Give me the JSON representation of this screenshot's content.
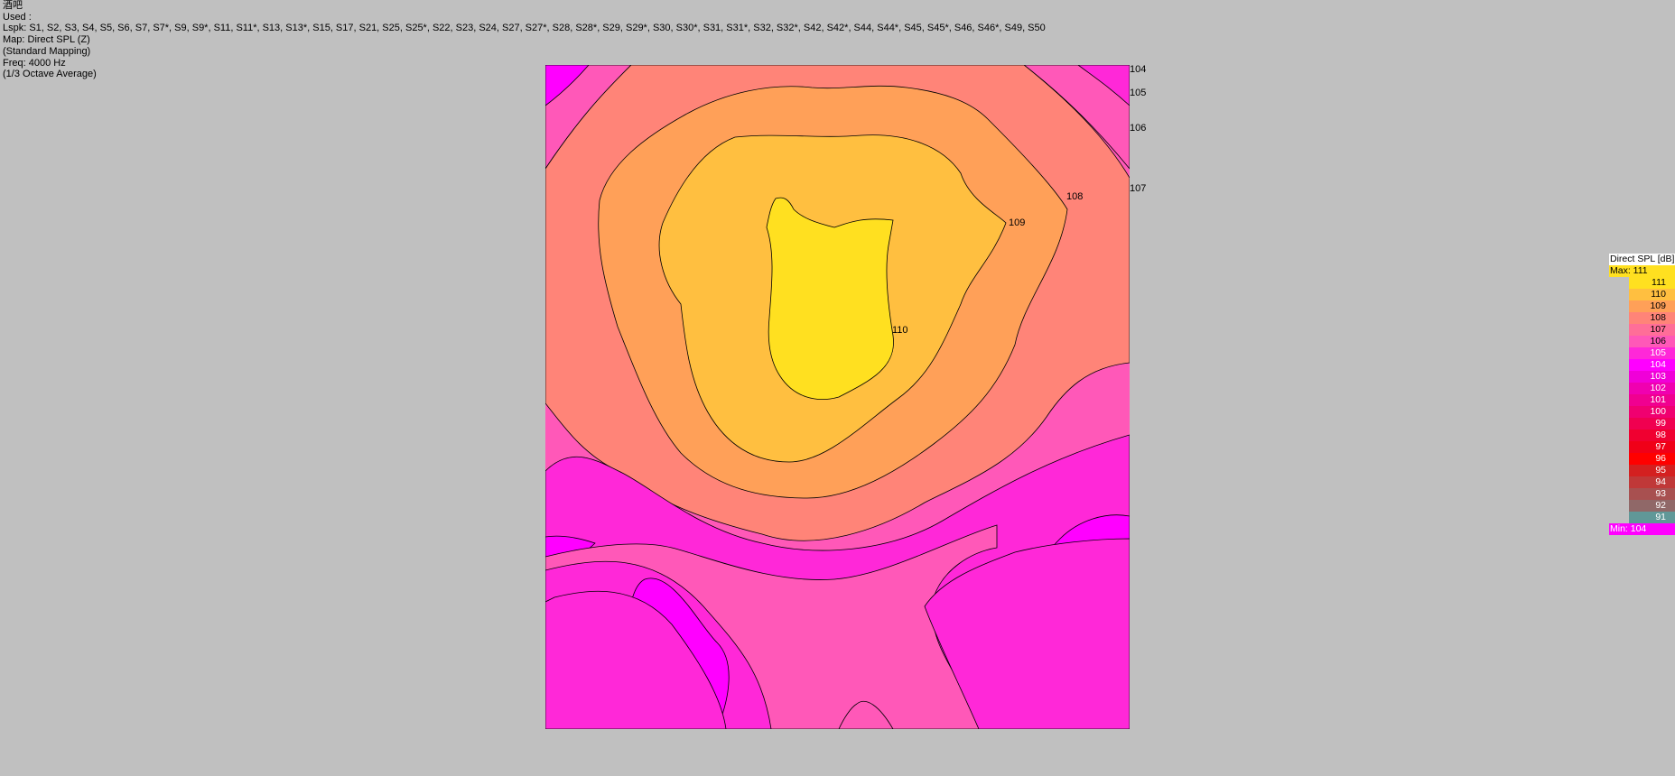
{
  "info": {
    "project": "酒吧",
    "used_label": "Used :",
    "lspk": "Lspk: S1, S2, S3, S4, S5, S6, S7, S7*, S9, S9*, S11, S11*, S13, S13*, S15, S17, S21, S25, S25*, S22, S23, S24, S27, S27*, S28, S28*, S29, S29*, S30, S30*, S31, S31*, S32, S32*, S42, S42*, S44, S44*, S45, S45*, S46, S46*, S49, S50",
    "map": "Map: Direct SPL (Z)",
    "mapping": "(Standard Mapping)",
    "freq": "Freq: 4000 Hz",
    "average": "(1/3 Octave Average)"
  },
  "chart_data": {
    "type": "heatmap",
    "title": "Direct SPL [dB]",
    "max_label": "Max:  111",
    "min_label": "Min:  104",
    "contour_levels": [
      104,
      105,
      106,
      107,
      108,
      109,
      110
    ],
    "contour_labels": [
      "108",
      "109",
      "110"
    ],
    "edge_labels": [
      "104",
      "105",
      "106",
      "107"
    ],
    "legend": [
      {
        "value": "111",
        "color": "#ffe020"
      },
      {
        "value": "110",
        "color": "#ffbf40"
      },
      {
        "value": "109",
        "color": "#ffa058"
      },
      {
        "value": "108",
        "color": "#ff8478"
      },
      {
        "value": "107",
        "color": "#ff6e98"
      },
      {
        "value": "106",
        "color": "#ff58b8"
      },
      {
        "value": "105",
        "color": "#ff28d8"
      },
      {
        "value": "104",
        "color": "#ff00ff"
      },
      {
        "value": "103",
        "color": "#f000d8"
      },
      {
        "value": "102",
        "color": "#f000b0"
      },
      {
        "value": "101",
        "color": "#f00090"
      },
      {
        "value": "100",
        "color": "#f00070"
      },
      {
        "value": "99",
        "color": "#f00050"
      },
      {
        "value": "98",
        "color": "#f00030"
      },
      {
        "value": "97",
        "color": "#f00018"
      },
      {
        "value": "96",
        "color": "#ff0000"
      },
      {
        "value": "95",
        "color": "#d42020"
      },
      {
        "value": "94",
        "color": "#c03838"
      },
      {
        "value": "93",
        "color": "#a85050"
      },
      {
        "value": "92",
        "color": "#906868"
      },
      {
        "value": "91",
        "color": "#609898"
      }
    ],
    "colors": {
      "bg": "#c0c0c0",
      "min_color": "#ff00ff",
      "max_color": "#ffe020"
    }
  }
}
